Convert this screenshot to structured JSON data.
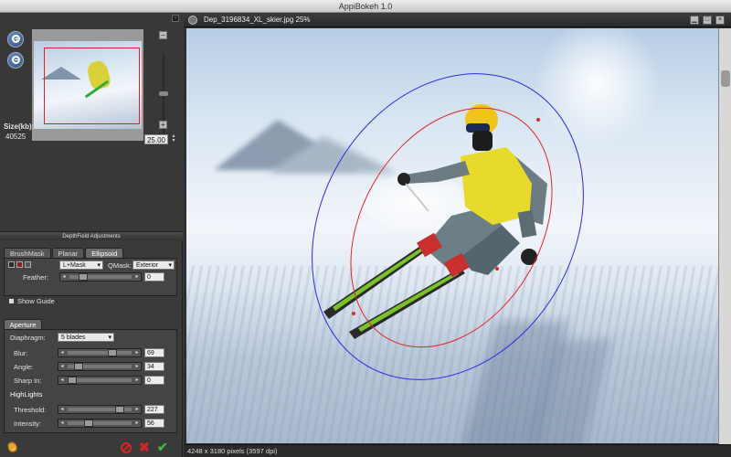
{
  "app": {
    "title": "AppiBokeh 1.0"
  },
  "navigator": {
    "zoom_value": "25.00",
    "size_label": "Size(kb):",
    "size_value": "40525",
    "plus_label": "+",
    "minus_label": "−"
  },
  "depthfield": {
    "header": "DepthField Adjustments",
    "tabs": [
      {
        "label": "BrushMask"
      },
      {
        "label": "Planar"
      },
      {
        "label": "Ellipsoid"
      }
    ],
    "mask_select": "L+Mask",
    "qmask_label": "QMask:",
    "qmask_select": "Exterior",
    "feather_label": "Feather:",
    "feather_value": "0",
    "show_guide_label": "Show Guide"
  },
  "aperture": {
    "tab_label": "Aperture",
    "diaphragm_label": "Diaphragm:",
    "diaphragm_select": "5 blades",
    "blur_label": "Blur:",
    "blur_value": "69",
    "angle_label": "Angle:",
    "angle_value": "34",
    "sharp_label": "Sharp In:",
    "sharp_value": "0",
    "highlights_label": "HighLights",
    "threshold_label": "Threshold:",
    "threshold_value": "227",
    "intensity_label": "Intensity:",
    "intensity_value": "56"
  },
  "image_window": {
    "title": "Dep_3196834_XL_skier.jpg 25%",
    "status": "4248 x 3180 pixels (3597 dpi)"
  },
  "icons": {
    "zoom_in": "zoom-in-icon",
    "zoom_out": "zoom-out-icon",
    "settings": "gear-icon",
    "reset": "no-entry-icon",
    "cancel": "x-icon",
    "apply": "check-icon"
  },
  "colors": {
    "outer_ellipse": "#2a2ae0",
    "inner_ellipse": "#e0262a",
    "thumb_rect": "#d8222a",
    "apply_green": "#3cb83c",
    "cancel_red": "#d52626"
  }
}
